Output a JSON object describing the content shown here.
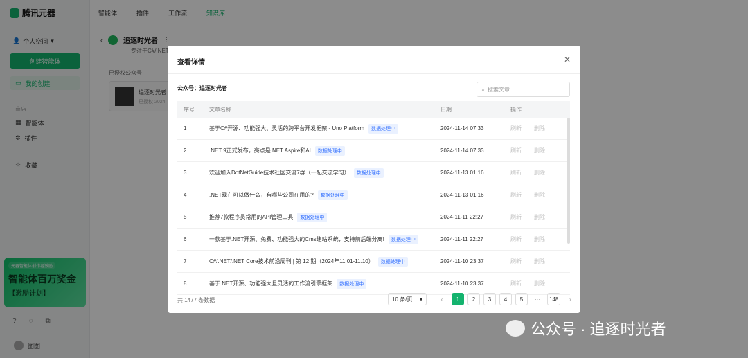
{
  "app": {
    "brand": "腾讯元器",
    "nav": [
      "智能体",
      "插件",
      "工作流",
      "知识库"
    ],
    "nav_active": "知识库",
    "space": "个人空间",
    "create_button": "创建智能体",
    "my_resources": "我的创建",
    "section_label": "商店",
    "side_items": [
      "智能体",
      "插件",
      "收藏"
    ],
    "promo": {
      "top": "元器智能体创作者激励",
      "big": "智能体百万奖金",
      "sub": "【激励计划】"
    },
    "user_name": "图图",
    "account_header": "追逐时光者",
    "account_desc": "专注于C#/.NET",
    "authorized_label": "已授权公众号",
    "card_title": "追逐时光者",
    "card_sub": "已授权 2024"
  },
  "modal": {
    "title": "查看详情",
    "account_label": "公众号：追逐时光者",
    "search_placeholder": "搜索文章",
    "columns": [
      "序号",
      "文章名称",
      "日期",
      "操作"
    ],
    "ops": [
      "刷新",
      "删除"
    ],
    "rows": [
      {
        "idx": "1",
        "title": "基于C#开源、功能强大、灵活的跨平台开发框架 - Uno Platform",
        "status": "数据处理中",
        "date": "2024-11-14 07:33"
      },
      {
        "idx": "2",
        "title": ".NET 9正式发布，亮点是.NET Aspire和AI",
        "status": "数据处理中",
        "date": "2024-11-14 07:33"
      },
      {
        "idx": "3",
        "title": "欢迎加入DotNetGuide技术社区交流7群（一起交流学习）",
        "status": "数据处理中",
        "date": "2024-11-13 01:16"
      },
      {
        "idx": "4",
        "title": ".NET现在可以做什么，有哪些公司在用的?",
        "status": "数据处理中",
        "date": "2024-11-13 01:16"
      },
      {
        "idx": "5",
        "title": "推荐7款程序员常用的API管理工具",
        "status": "数据处理中",
        "date": "2024-11-11 22:27"
      },
      {
        "idx": "6",
        "title": "一款基于.NET开源、免费、功能强大的Cms建站系统，支持前后端分离!",
        "status": "数据处理中",
        "date": "2024-11-11 22:27"
      },
      {
        "idx": "7",
        "title": "C#/.NET/.NET Core技术前沿周刊 | 第 12 期（2024年11.01-11.10）",
        "status": "数据处理中",
        "date": "2024-11-10 23:37"
      },
      {
        "idx": "8",
        "title": "基于.NET开源、功能强大且灵活的工作流引擎框架",
        "status": "数据处理中",
        "date": "2024-11-10 23:37"
      }
    ],
    "total": "共 1477 条数据",
    "page_size": "10 条/页",
    "pages": [
      "1",
      "2",
      "3",
      "4",
      "5"
    ],
    "ellipsis": "···",
    "last_page": "148",
    "accent": "#14b36e"
  },
  "watermark": "公众号 · 追逐时光者"
}
